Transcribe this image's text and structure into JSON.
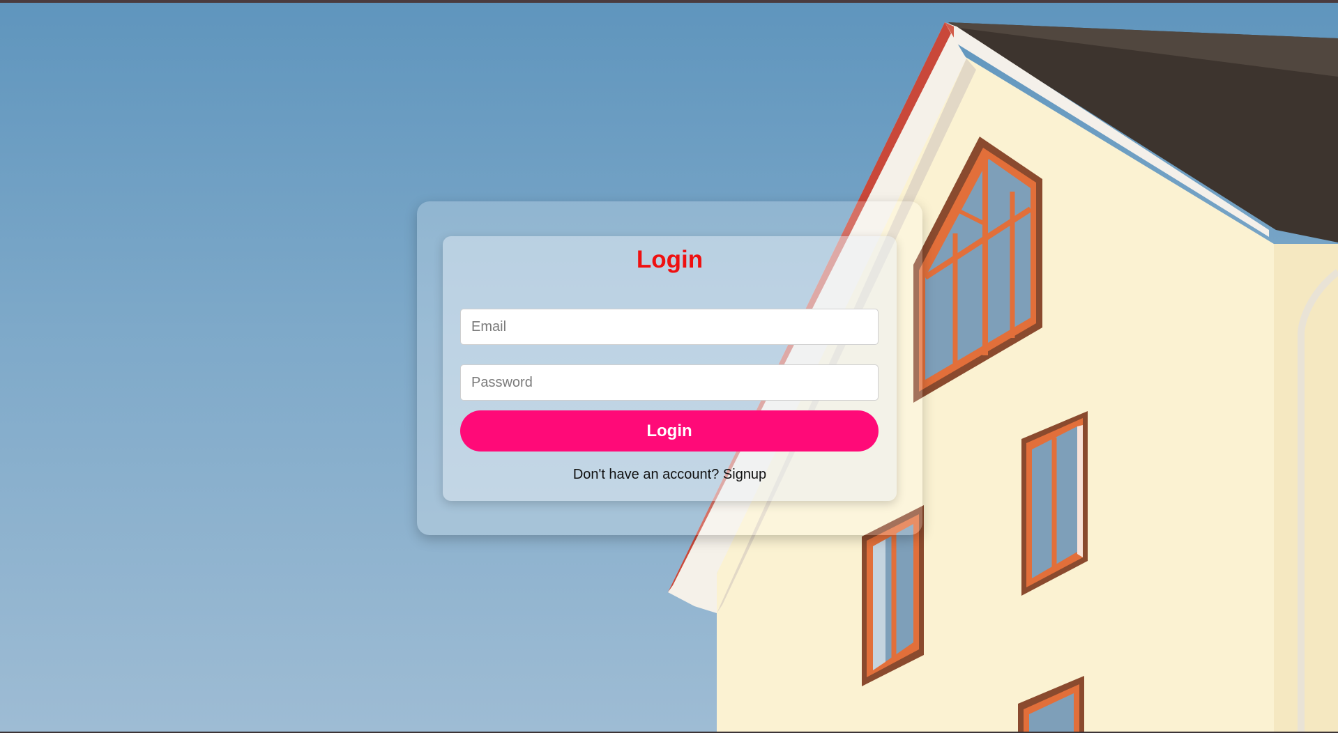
{
  "colors": {
    "title": "#ef1010",
    "button": "#ff0a78",
    "sky": "#6f9fc4",
    "wall": "#fbf2d2"
  },
  "background": {
    "image": "house-photo"
  },
  "login_form": {
    "title": "Login",
    "email_placeholder": "Email",
    "password_placeholder": "Password",
    "submit_label": "Login",
    "signup_prompt": "Don't have an account?",
    "signup_link": "Signup"
  }
}
